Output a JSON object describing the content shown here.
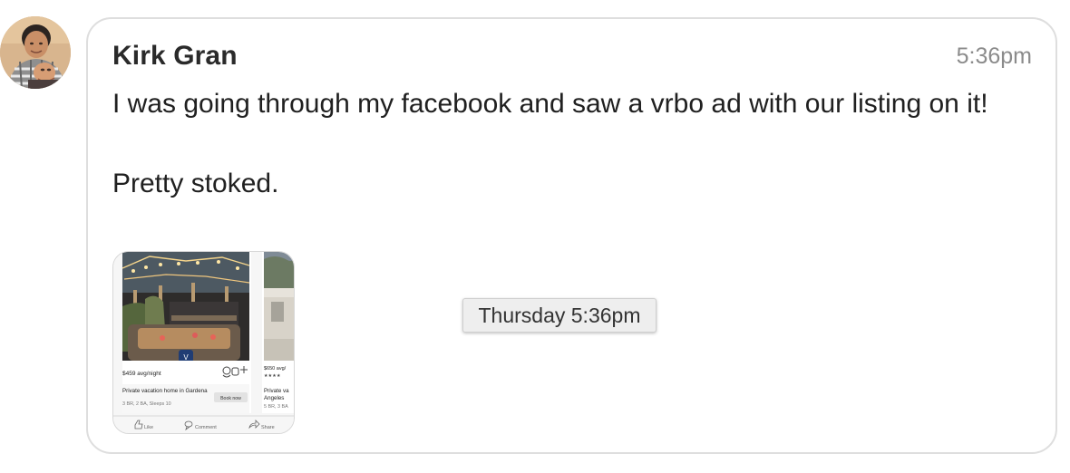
{
  "message": {
    "sender": "Kirk Gran",
    "time": "5:36pm",
    "paragraphs": [
      "I was going through my facebook and saw a vrbo ad with our listing on it!",
      "Pretty stoked."
    ],
    "tooltip": "Thursday 5:36pm"
  },
  "attachment": {
    "card1": {
      "price": "$459 avg/night",
      "title": "Private vacation home in Gardena",
      "details": "3 BR, 2 BA, Sleeps 10",
      "cta": "Book now"
    },
    "card2": {
      "price": "$650 avg/",
      "title": "Private va",
      "subtitle": "Angeles",
      "details": "5 BR, 3 BA"
    },
    "actions": {
      "like": "Like",
      "comment": "Comment",
      "share": "Share"
    }
  }
}
